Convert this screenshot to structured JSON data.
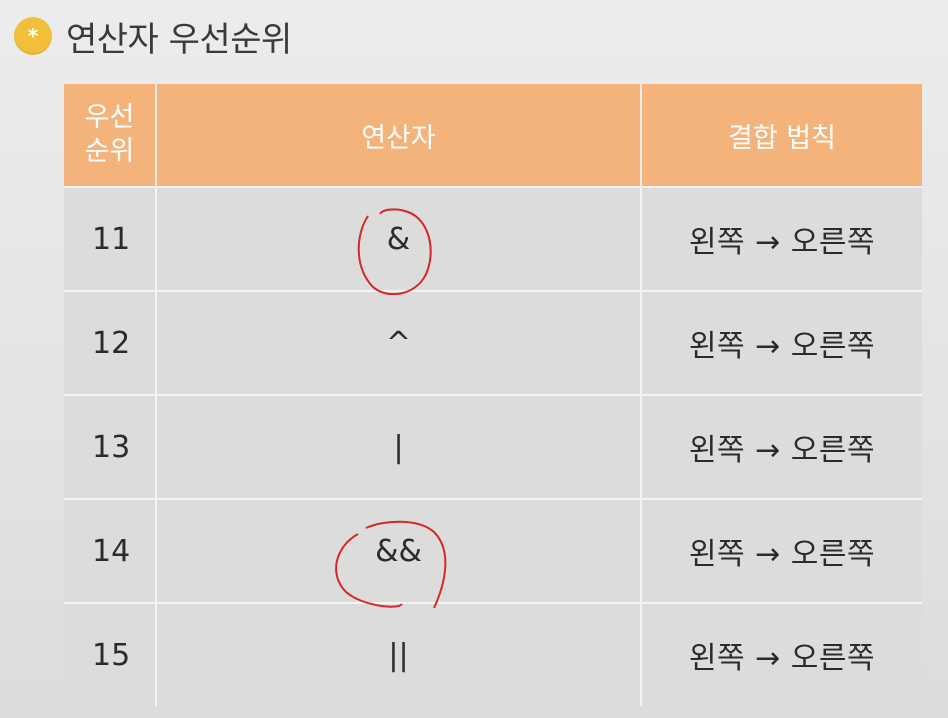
{
  "title": {
    "badge_glyph": "*",
    "text": "연산자 우선순위"
  },
  "table": {
    "headers": {
      "rank_line1": "우선",
      "rank_line2": "순위",
      "operator": "연산자",
      "associativity": "결합 법칙"
    },
    "rows": [
      {
        "rank": "11",
        "operator": "&",
        "associativity": "왼쪽 → 오른쪽",
        "circled": true
      },
      {
        "rank": "12",
        "operator": "^",
        "associativity": "왼쪽 → 오른쪽",
        "circled": false
      },
      {
        "rank": "13",
        "operator": "|",
        "associativity": "왼쪽 → 오른쪽",
        "circled": false
      },
      {
        "rank": "14",
        "operator": "&&",
        "associativity": "왼쪽 → 오른쪽",
        "circled": true
      },
      {
        "rank": "15",
        "operator": "||",
        "associativity": "왼쪽 → 오른쪽",
        "circled": false
      }
    ]
  },
  "colors": {
    "header_bg": "#f5b37c",
    "cell_bg": "#dcdcdc",
    "badge": "#f2bf3a",
    "annotation": "#d8252b"
  }
}
